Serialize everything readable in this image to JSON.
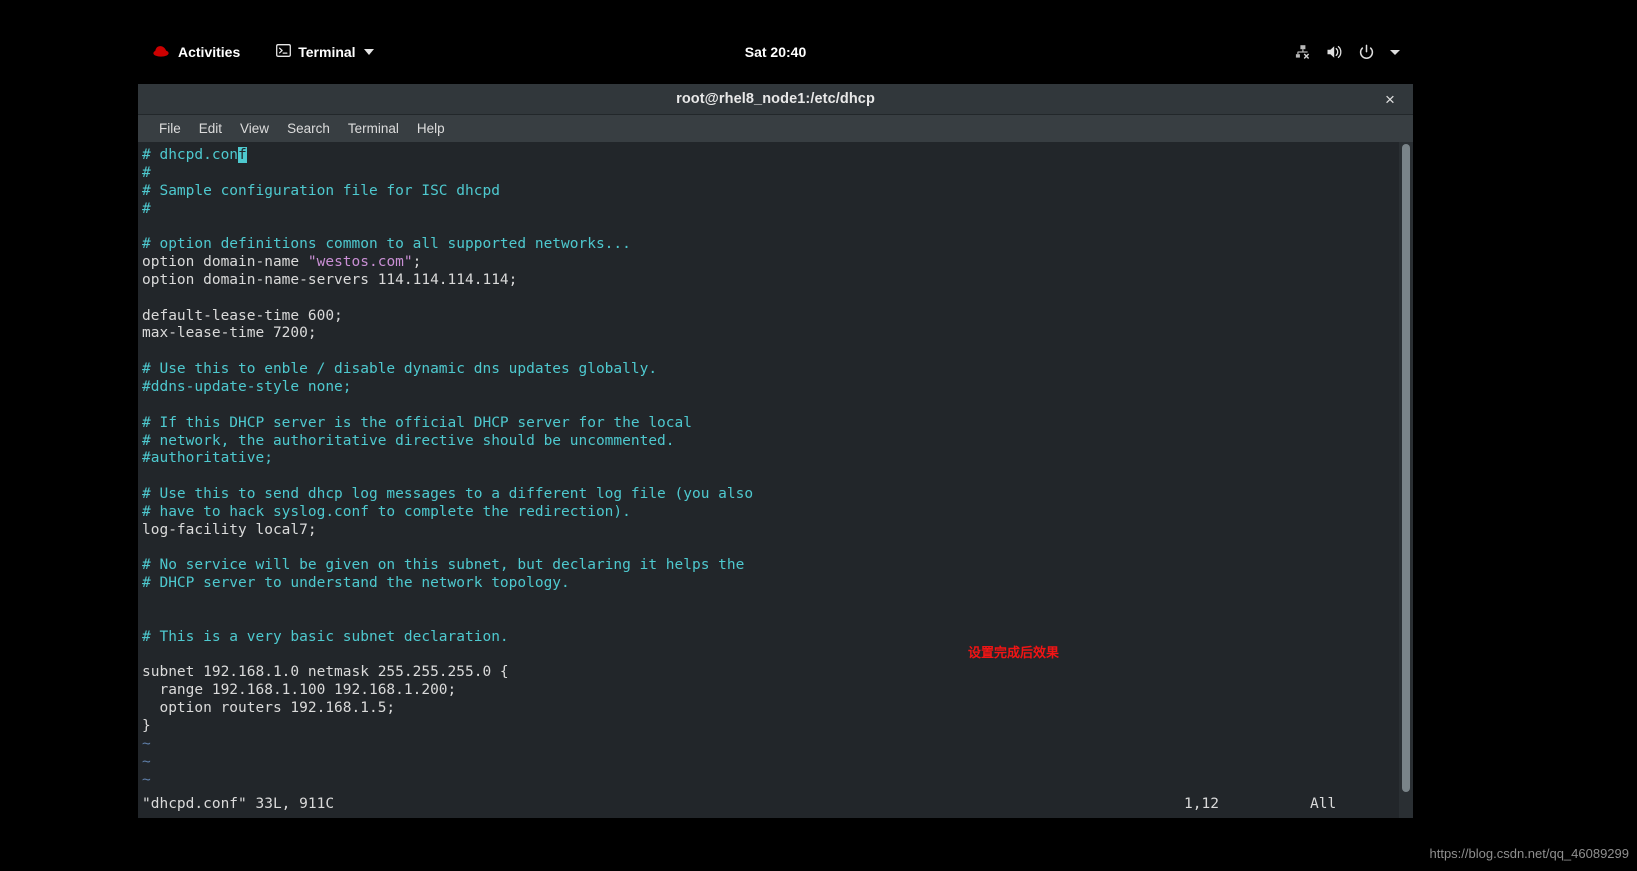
{
  "topbar": {
    "activities_label": "Activities",
    "app_menu_label": "Terminal",
    "clock": "Sat 20:40",
    "icons": [
      "redhat-logo-icon",
      "terminal-icon",
      "chevron-down-icon",
      "network-disconnected-icon",
      "volume-icon",
      "power-icon",
      "chevron-down-icon"
    ]
  },
  "window": {
    "title": "root@rhel8_node1:/etc/dhcp",
    "close_label": "×",
    "menus": [
      {
        "label": "File"
      },
      {
        "label": "Edit"
      },
      {
        "label": "View"
      },
      {
        "label": "Search"
      },
      {
        "label": "Terminal"
      },
      {
        "label": "Help"
      }
    ]
  },
  "editor": {
    "lines": [
      {
        "segments": [
          {
            "text": "# dhcpd.con",
            "style": "comment"
          },
          {
            "text": "f",
            "style": "cursor"
          }
        ]
      },
      {
        "segments": [
          {
            "text": "#",
            "style": "comment"
          }
        ]
      },
      {
        "segments": [
          {
            "text": "# Sample configuration file for ISC dhcpd",
            "style": "comment"
          }
        ]
      },
      {
        "segments": [
          {
            "text": "#",
            "style": "comment"
          }
        ]
      },
      {
        "segments": [
          {
            "text": "",
            "style": "normal"
          }
        ]
      },
      {
        "segments": [
          {
            "text": "# option definitions common to all supported networks...",
            "style": "comment"
          }
        ]
      },
      {
        "segments": [
          {
            "text": "option domain-name ",
            "style": "normal"
          },
          {
            "text": "\"westos.com\"",
            "style": "string"
          },
          {
            "text": ";",
            "style": "normal"
          }
        ]
      },
      {
        "segments": [
          {
            "text": "option domain-name-servers 114.114.114.114;",
            "style": "normal"
          }
        ]
      },
      {
        "segments": [
          {
            "text": "",
            "style": "normal"
          }
        ]
      },
      {
        "segments": [
          {
            "text": "default-lease-time 600;",
            "style": "normal"
          }
        ]
      },
      {
        "segments": [
          {
            "text": "max-lease-time 7200;",
            "style": "normal"
          }
        ]
      },
      {
        "segments": [
          {
            "text": "",
            "style": "normal"
          }
        ]
      },
      {
        "segments": [
          {
            "text": "# Use this to enble / disable dynamic dns updates globally.",
            "style": "comment"
          }
        ]
      },
      {
        "segments": [
          {
            "text": "#ddns-update-style none;",
            "style": "comment"
          }
        ]
      },
      {
        "segments": [
          {
            "text": "",
            "style": "normal"
          }
        ]
      },
      {
        "segments": [
          {
            "text": "# If this DHCP server is the official DHCP server for the local",
            "style": "comment"
          }
        ]
      },
      {
        "segments": [
          {
            "text": "# network, the authoritative directive should be uncommented.",
            "style": "comment"
          }
        ]
      },
      {
        "segments": [
          {
            "text": "#authoritative;",
            "style": "comment"
          }
        ]
      },
      {
        "segments": [
          {
            "text": "",
            "style": "normal"
          }
        ]
      },
      {
        "segments": [
          {
            "text": "# Use this to send dhcp log messages to a different log file (you also",
            "style": "comment"
          }
        ]
      },
      {
        "segments": [
          {
            "text": "# have to hack syslog.conf to complete the redirection).",
            "style": "comment"
          }
        ]
      },
      {
        "segments": [
          {
            "text": "log-facility local7;",
            "style": "normal"
          }
        ]
      },
      {
        "segments": [
          {
            "text": "",
            "style": "normal"
          }
        ]
      },
      {
        "segments": [
          {
            "text": "# No service will be given on this subnet, but declaring it helps the",
            "style": "comment"
          }
        ]
      },
      {
        "segments": [
          {
            "text": "# DHCP server to understand the network topology.",
            "style": "comment"
          }
        ]
      },
      {
        "segments": [
          {
            "text": "",
            "style": "normal"
          }
        ]
      },
      {
        "segments": [
          {
            "text": "",
            "style": "normal"
          }
        ]
      },
      {
        "segments": [
          {
            "text": "# This is a very basic subnet declaration.",
            "style": "comment"
          }
        ]
      },
      {
        "segments": [
          {
            "text": "",
            "style": "normal"
          }
        ]
      },
      {
        "segments": [
          {
            "text": "subnet 192.168.1.0 netmask 255.255.255.0 {",
            "style": "normal"
          }
        ]
      },
      {
        "segments": [
          {
            "text": "  range 192.168.1.100 192.168.1.200;",
            "style": "normal"
          }
        ]
      },
      {
        "segments": [
          {
            "text": "  option routers 192.168.1.5;",
            "style": "normal"
          }
        ]
      },
      {
        "segments": [
          {
            "text": "}",
            "style": "normal"
          }
        ]
      },
      {
        "segments": [
          {
            "text": "~",
            "style": "tilde"
          }
        ]
      },
      {
        "segments": [
          {
            "text": "~",
            "style": "tilde"
          }
        ]
      },
      {
        "segments": [
          {
            "text": "~",
            "style": "tilde"
          }
        ]
      }
    ],
    "statusline": {
      "file_info": "\"dhcpd.conf\" 33L, 911C",
      "position": "1,12",
      "scroll_state": "All"
    }
  },
  "annotation": {
    "text": "设置完成后效果",
    "color": "#f21414"
  },
  "watermark": {
    "text": "https://blog.csdn.net/qq_46089299"
  },
  "colors": {
    "desktop_bg": "#000000",
    "titlebar_bg": "#31373b",
    "menubar_bg": "#383e42",
    "terminal_bg": "#22262a",
    "comment": "#4ec9cf",
    "string": "#c98fd4",
    "normal_text": "#dadada",
    "tilde": "#5e7ea8",
    "cursor": "#4ec9cf"
  }
}
